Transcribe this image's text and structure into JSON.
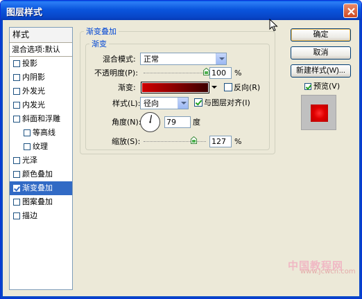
{
  "window": {
    "title": "图层样式"
  },
  "styles_panel": {
    "header": "样式",
    "blend_options": "混合选项:默认",
    "items": [
      {
        "label": "投影",
        "checked": false,
        "sub": false
      },
      {
        "label": "内阴影",
        "checked": false,
        "sub": false
      },
      {
        "label": "外发光",
        "checked": false,
        "sub": false
      },
      {
        "label": "内发光",
        "checked": false,
        "sub": false
      },
      {
        "label": "斜面和浮雕",
        "checked": false,
        "sub": false
      },
      {
        "label": "等高线",
        "checked": false,
        "sub": true
      },
      {
        "label": "纹理",
        "checked": false,
        "sub": true
      },
      {
        "label": "光泽",
        "checked": false,
        "sub": false
      },
      {
        "label": "颜色叠加",
        "checked": false,
        "sub": false
      },
      {
        "label": "渐变叠加",
        "checked": true,
        "sub": false,
        "selected": true
      },
      {
        "label": "图案叠加",
        "checked": false,
        "sub": false
      },
      {
        "label": "描边",
        "checked": false,
        "sub": false
      }
    ]
  },
  "buttons": {
    "ok": "确定",
    "cancel": "取消",
    "new_style": "新建样式(W)...",
    "preview": "预览(V)",
    "preview_checked": true
  },
  "gradient_overlay": {
    "group_title": "渐变叠加",
    "subgroup_title": "渐变",
    "blend_mode_label": "混合模式:",
    "blend_mode_value": "正常",
    "opacity_label": "不透明度(P):",
    "opacity_value": "100",
    "opacity_unit": "%",
    "opacity_fraction": 1.0,
    "gradient_label": "渐变:",
    "reverse_label": "反向(R)",
    "reverse_checked": false,
    "style_label": "样式(L):",
    "style_value": "径向",
    "align_label": "与图层对齐(I)",
    "align_checked": true,
    "angle_label": "角度(N):",
    "angle_value": "79",
    "angle_unit": "度",
    "scale_label": "缩放(S):",
    "scale_value": "127",
    "scale_unit": "%",
    "scale_fraction": 0.8
  },
  "colors": {
    "gradient_start": "#d00000",
    "gradient_end": "#3a0000",
    "preview_swatch": "#e00000",
    "selection": "#316ac5",
    "title_bar": "#0a55dd"
  },
  "watermark": {
    "top": "中国教程网",
    "bottom": "www.jcwcn.com"
  }
}
